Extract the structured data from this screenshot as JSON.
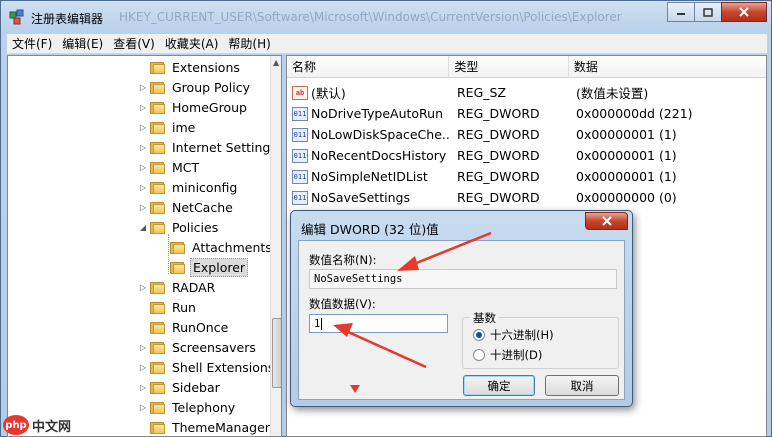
{
  "window": {
    "title": "注册表编辑器",
    "title_ghost": "HKEY_CURRENT_USER\\Software\\Microsoft\\Windows\\CurrentVersion\\Policies\\Explorer"
  },
  "menu": [
    "文件(F)",
    "编辑(E)",
    "查看(V)",
    "收藏夹(A)",
    "帮助(H)"
  ],
  "tree": {
    "items": [
      {
        "label": "Extensions",
        "arrow": ""
      },
      {
        "label": "Group Policy",
        "arrow": "▷"
      },
      {
        "label": "HomeGroup",
        "arrow": "▷"
      },
      {
        "label": "ime",
        "arrow": "▷"
      },
      {
        "label": "Internet Settings",
        "arrow": "▷"
      },
      {
        "label": "MCT",
        "arrow": "▷"
      },
      {
        "label": "miniconfig",
        "arrow": "▷"
      },
      {
        "label": "NetCache",
        "arrow": "▷"
      },
      {
        "label": "Policies",
        "arrow": "◢"
      },
      {
        "label": "Attachments",
        "arrow": ""
      },
      {
        "label": "Explorer",
        "arrow": ""
      },
      {
        "label": "RADAR",
        "arrow": "▷"
      },
      {
        "label": "Run",
        "arrow": ""
      },
      {
        "label": "RunOnce",
        "arrow": ""
      },
      {
        "label": "Screensavers",
        "arrow": "▷"
      },
      {
        "label": "Shell Extensions",
        "arrow": "▷"
      },
      {
        "label": "Sidebar",
        "arrow": "▷"
      },
      {
        "label": "Telephony",
        "arrow": "▷"
      },
      {
        "label": "ThemeManager",
        "arrow": ""
      }
    ],
    "selected": "Explorer"
  },
  "list": {
    "headers": [
      "名称",
      "类型",
      "数据"
    ],
    "rows": [
      {
        "name": "(默认)",
        "type": "REG_SZ",
        "data": "(数值未设置)",
        "icon": "ab"
      },
      {
        "name": "NoDriveTypeAutoRun",
        "type": "REG_DWORD",
        "data": "0x000000dd (221)",
        "icon": "011"
      },
      {
        "name": "NoLowDiskSpaceChe...",
        "type": "REG_DWORD",
        "data": "0x00000001 (1)",
        "icon": "011"
      },
      {
        "name": "NoRecentDocsHistory",
        "type": "REG_DWORD",
        "data": "0x00000001 (1)",
        "icon": "011"
      },
      {
        "name": "NoSimpleNetIDList",
        "type": "REG_DWORD",
        "data": "0x00000001 (1)",
        "icon": "011"
      },
      {
        "name": "NoSaveSettings",
        "type": "REG_DWORD",
        "data": "0x00000000 (0)",
        "icon": "011"
      }
    ]
  },
  "dialog": {
    "title": "编辑 DWORD (32 位)值",
    "value_name_label": "数值名称(N):",
    "value_name": "NoSaveSettings",
    "value_data_label": "数值数据(V):",
    "value_data": "1",
    "base_label": "基数",
    "radio_hex": "十六进制(H)",
    "radio_dec": "十进制(D)",
    "selected_base": "hex",
    "ok_label": "确定",
    "cancel_label": "取消"
  },
  "watermark": {
    "logo": "php",
    "text": "中文网"
  },
  "colors": {
    "annotation_arrow": "#e8372c",
    "selection_bg": "#dcdcdc",
    "titlebar": "#c5d9ee"
  }
}
